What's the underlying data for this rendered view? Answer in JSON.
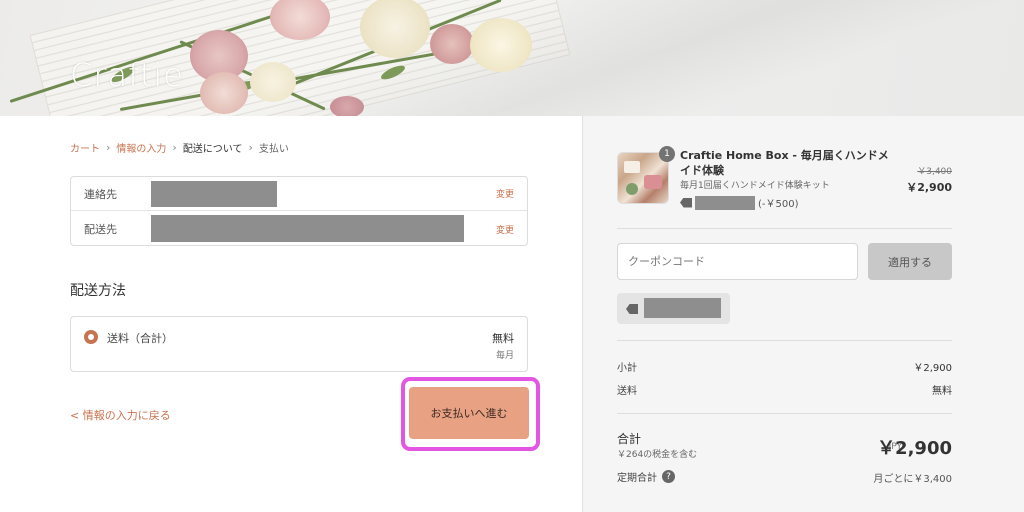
{
  "header": {
    "logo_text": "Craftie"
  },
  "breadcrumb": {
    "items": [
      "カート",
      "情報の入力",
      "配送について",
      "支払い"
    ],
    "separator": ">"
  },
  "review": {
    "contact_label": "連絡先",
    "shipping_label": "配送先",
    "change_label": "変更"
  },
  "shipping": {
    "section_title": "配送方法",
    "method_label": "送料（合計）",
    "price": "無料",
    "frequency": "毎月"
  },
  "actions": {
    "back_label": "< 情報の入力に戻る",
    "continue_label": "お支払いへ進む"
  },
  "order": {
    "quantity": "1",
    "product_name": "Craftie Home Box - 毎月届くハンドメイド体験",
    "product_subtitle": "毎月1回届くハンドメイド体験キット",
    "discount_amount": "(-￥500)",
    "price_original": "￥3,400",
    "price_now": "￥2,900"
  },
  "coupon": {
    "placeholder": "クーポンコード",
    "apply_label": "適用する"
  },
  "summary": {
    "subtotal_label": "小計",
    "subtotal_value": "￥2,900",
    "shipping_label": "送料",
    "shipping_value": "無料",
    "total_label": "合計",
    "tax_note": "￥264の税金を含む",
    "currency": "JPY",
    "total_value": "￥2,900",
    "recurring_label": "定期合計",
    "recurring_value": "月ごとに￥3,400"
  },
  "colors": {
    "accent": "#c8734f",
    "button": "#e8a283",
    "highlight": "#e356e2"
  }
}
